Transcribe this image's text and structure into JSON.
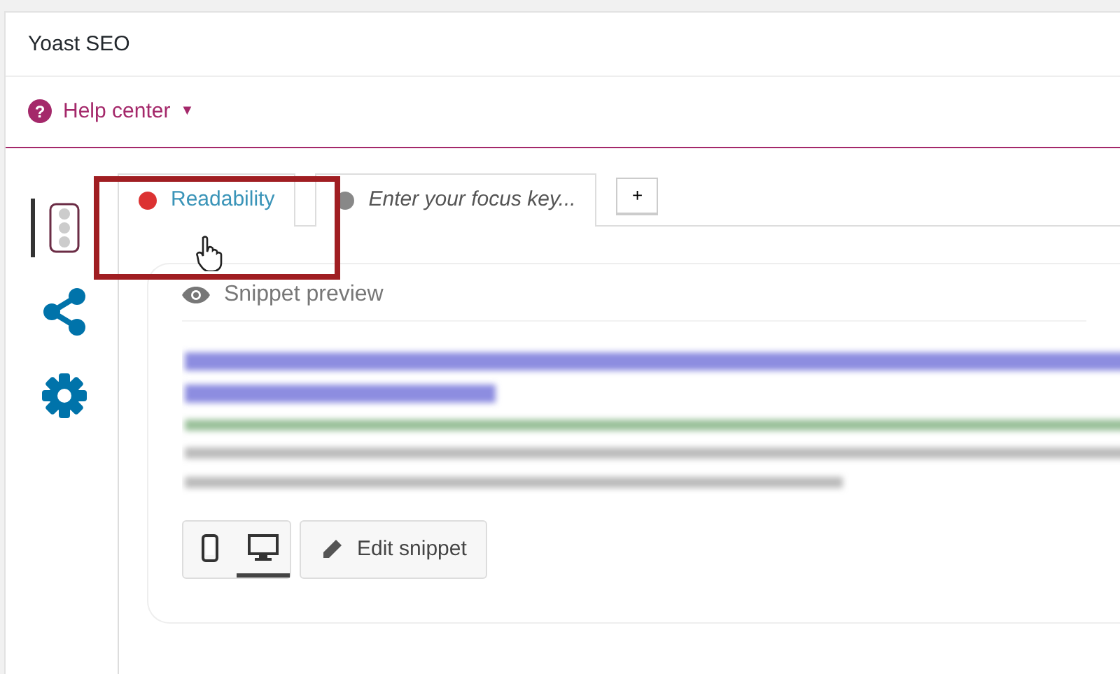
{
  "panel": {
    "title": "Yoast SEO"
  },
  "help": {
    "label": "Help center",
    "icon": "?",
    "caret": "▼"
  },
  "sidebar": {
    "items": [
      {
        "kind": "readability",
        "selected": true
      },
      {
        "kind": "share",
        "selected": false
      },
      {
        "kind": "settings",
        "selected": false
      }
    ]
  },
  "tabs": [
    {
      "label": "Readability",
      "color": "#dc3232",
      "selected": true,
      "kind": "label"
    },
    {
      "label": "Enter your focus key...",
      "color": "#888888",
      "selected": false,
      "kind": "placeholder"
    }
  ],
  "add_tab": {
    "label": "+"
  },
  "snippet": {
    "heading": "Snippet preview",
    "modes": [
      {
        "kind": "mobile",
        "selected": false
      },
      {
        "kind": "desktop",
        "selected": true
      }
    ],
    "edit_button": "Edit snippet"
  },
  "highlight": true
}
